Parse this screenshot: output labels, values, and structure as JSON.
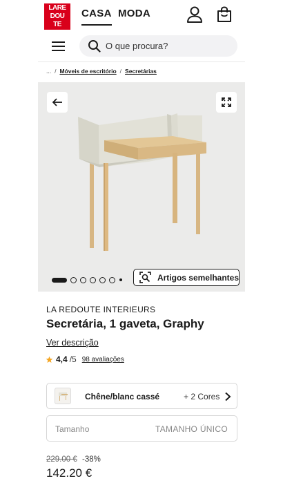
{
  "header": {
    "logo_lines": [
      "LARE",
      "DOU",
      "TE"
    ],
    "tabs": [
      {
        "label": "CASA",
        "active": true
      },
      {
        "label": "MODA",
        "active": false
      }
    ],
    "icons": [
      "user-icon",
      "shopping-bag-icon"
    ]
  },
  "search": {
    "placeholder": "O que procura?",
    "menu_icon": "hamburger-menu-icon",
    "search_icon": "search-icon"
  },
  "breadcrumb": {
    "root": "...",
    "items": [
      "Móveis de escritório",
      "Secretárias"
    ]
  },
  "gallery": {
    "similar_button_label": "Artigos semelhantes",
    "image_count": 6,
    "active_index": 0,
    "colors": {
      "background": "#ebebea",
      "desk_panel": "#d9d8cc",
      "wood": "#d8b783"
    }
  },
  "product": {
    "brand": "LA REDOUTE INTERIEURS",
    "title": "Secretária, 1 gaveta, Graphy",
    "description_link": "Ver descrição",
    "rating": {
      "value": "4,4",
      "max": "/5",
      "reviews": "98 avaliações",
      "star_color": "#f5a623"
    }
  },
  "options": {
    "color": {
      "name": "Chêne/blanc cassé",
      "more": "+ 2 Cores"
    },
    "size": {
      "label": "Tamanho",
      "value": "TAMANHO ÚNICO"
    }
  },
  "price": {
    "old": "229.00 €",
    "discount": "-38%",
    "current": "142.20 €"
  }
}
